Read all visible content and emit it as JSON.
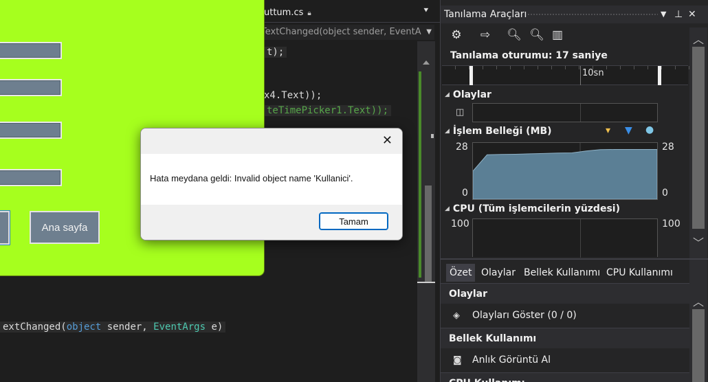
{
  "editor": {
    "tab_title": "uttum.cs",
    "member_combo": "TextChanged(object sender, EventA",
    "code_line_1": "t);",
    "code_line_2": "x4.Text));",
    "code_line_3": "teTimePicker1.Text));",
    "code_sig_prefix": "extChanged(",
    "code_sig_kw": "object",
    "code_sig_mid": " sender, ",
    "code_sig_type": "EventArgs",
    "code_sig_suffix": " e)"
  },
  "app_window": {
    "background_color": "#a6ff1e",
    "home_button_label": "Ana sayfa"
  },
  "message_box": {
    "message": "Hata meydana geldi: Invalid object name 'Kullanici'.",
    "ok_label": "Tamam"
  },
  "diagnostics": {
    "title": "Tanılama Araçları",
    "session_label": "Tanılama oturumu: 17 saniye",
    "timeline_label": "10sn",
    "events_header": "Olaylar",
    "memory_header": "İşlem Belleği (MB)",
    "memory_chart": {
      "y_max": 28,
      "y_min": 0,
      "values": [
        14,
        22.5,
        22.7,
        22.8,
        23.0,
        23.2,
        23.4,
        23.5,
        24.5,
        25.2,
        25.3,
        25.3,
        25.3,
        25.3
      ],
      "fill_color": "#5b7f95"
    },
    "cpu_header": "CPU (Tüm işlemcilerin yüzdesi)",
    "cpu_max": 100,
    "tabs": [
      "Özet",
      "Olaylar",
      "Bellek Kullanımı",
      "CPU Kullanımı"
    ],
    "summary": {
      "events_title": "Olaylar",
      "events_action": "Olayları Göster (0 / 0)",
      "memory_title": "Bellek Kullanımı",
      "memory_action": "Anlık Görüntü Al",
      "cpu_title": "CPU Kullanımı"
    }
  }
}
